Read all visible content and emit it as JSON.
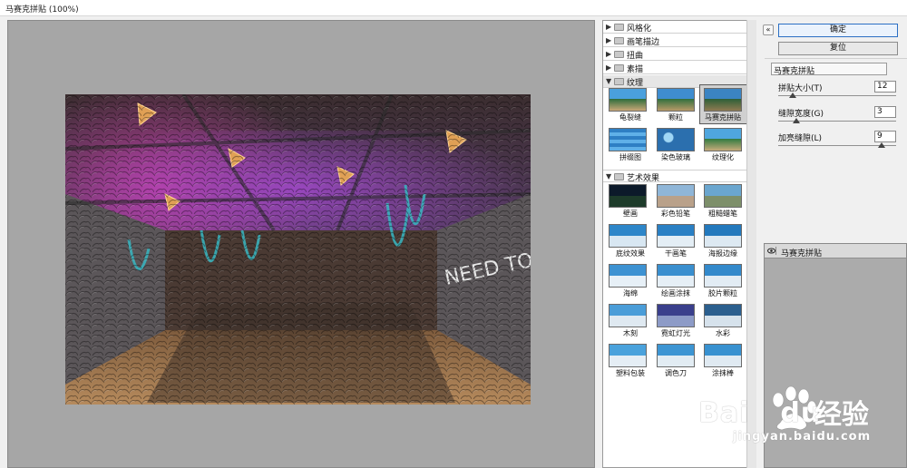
{
  "window": {
    "title": "马赛克拼贴 (100%)"
  },
  "gallery": {
    "categories_top": [
      {
        "label": "风格化",
        "expanded": false
      },
      {
        "label": "画笔描边",
        "expanded": false
      },
      {
        "label": "扭曲",
        "expanded": false
      },
      {
        "label": "素描",
        "expanded": false
      },
      {
        "label": "纹理",
        "expanded": true
      }
    ],
    "texture_filters": [
      "龟裂缝",
      "颗粒",
      "马赛克拼贴",
      "拼缀图",
      "染色玻璃",
      "纹理化"
    ],
    "selected_filter": "马赛克拼贴",
    "art_category": {
      "label": "艺术效果",
      "expanded": true
    },
    "art_filters": [
      "壁画",
      "彩色铅笔",
      "粗糙蜡笔",
      "底纹效果",
      "干画笔",
      "海报边缘",
      "海绵",
      "绘画涂抹",
      "胶片颗粒",
      "木刻",
      "霓虹灯光",
      "水彩",
      "塑料包装",
      "调色刀",
      "涂抹棒"
    ]
  },
  "buttons": {
    "ok": "确定",
    "reset": "复位",
    "collapse": "«"
  },
  "settings": {
    "filter_select": "马赛克拼贴",
    "params": [
      {
        "label": "拼贴大小(T)",
        "value": "12",
        "level": 0.12
      },
      {
        "label": "缝隙宽度(G)",
        "value": "3",
        "level": 0.15
      },
      {
        "label": "加亮缝隙(L)",
        "value": "9",
        "level": 0.88
      }
    ]
  },
  "layers": {
    "items": [
      {
        "label": "马赛克拼贴"
      }
    ]
  },
  "watermark": {
    "brand": "Bai",
    "brand2": "du",
    "cn": "经验",
    "url": "jingyan.baidu.com"
  },
  "colors": {
    "ok_border": "#2b6fc4",
    "preview_bg": "#a6a6a6"
  }
}
